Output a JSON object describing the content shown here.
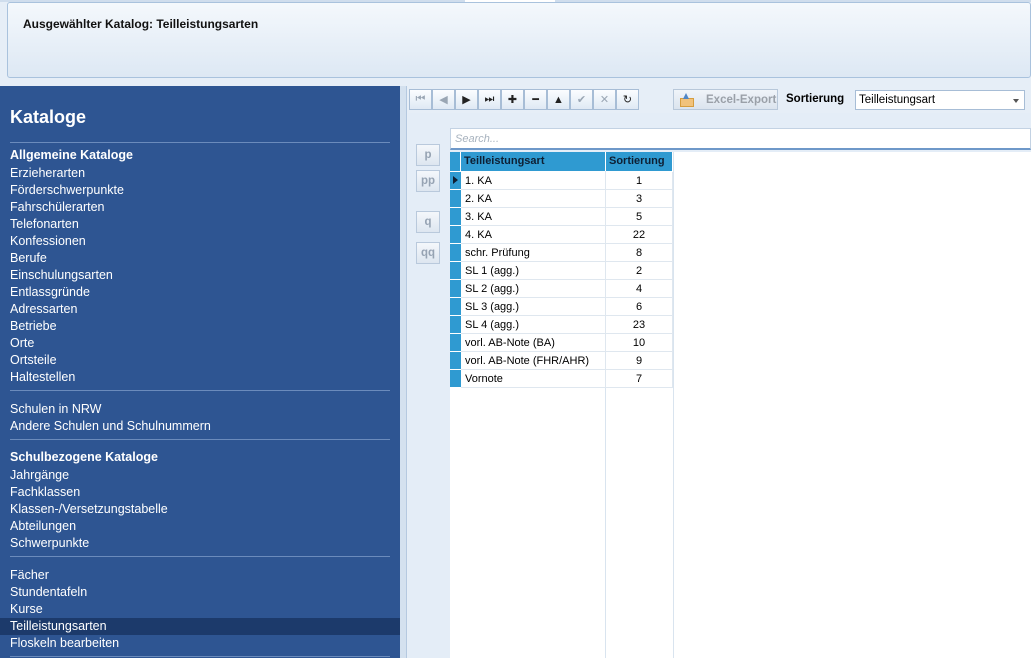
{
  "header": {
    "title": "Ausgewählter Katalog: Teilleistungsarten"
  },
  "sidebar": {
    "title": "Kataloge",
    "sections": [
      {
        "heading": "Allgemeine Kataloge",
        "items": [
          "Erzieherarten",
          "Förderschwerpunkte",
          "Fahrschülerarten",
          "Telefonarten",
          "Konfessionen",
          "Berufe",
          "Einschulungsarten",
          "Entlassgründe",
          "Adressarten",
          "Betriebe",
          "Orte",
          "Ortsteile",
          "Haltestellen"
        ]
      },
      {
        "heading": "",
        "items": [
          "Schulen in NRW",
          "Andere Schulen und Schulnummern"
        ]
      },
      {
        "heading": "Schulbezogene Kataloge",
        "items": [
          "Jahrgänge",
          "Fachklassen",
          "Klassen-/Versetzungstabelle",
          "Abteilungen",
          "Schwerpunkte"
        ]
      },
      {
        "heading": "",
        "items": [
          "Fächer",
          "Stundentafeln",
          "Kurse",
          "Teilleistungsarten",
          "Floskeln bearbeiten"
        ]
      }
    ],
    "active_item": "Teilleistungsarten"
  },
  "toolbar": {
    "buttons": [
      {
        "name": "first-record-icon",
        "glyph": "⏮",
        "enabled": false
      },
      {
        "name": "prev-record-icon",
        "glyph": "◀",
        "enabled": false
      },
      {
        "name": "next-record-icon",
        "glyph": "▶",
        "enabled": true
      },
      {
        "name": "last-record-icon",
        "glyph": "⏭",
        "enabled": true
      },
      {
        "name": "add-record-icon",
        "glyph": "✚",
        "enabled": true
      },
      {
        "name": "delete-record-icon",
        "glyph": "━",
        "enabled": true
      },
      {
        "name": "edit-record-icon",
        "glyph": "▲",
        "enabled": true
      },
      {
        "name": "post-edit-icon",
        "glyph": "✔",
        "enabled": false
      },
      {
        "name": "cancel-edit-icon",
        "glyph": "✕",
        "enabled": false
      },
      {
        "name": "refresh-icon",
        "glyph": "↻",
        "enabled": true
      }
    ],
    "excel_export_label": "Excel-Export",
    "sort_label": "Sortierung",
    "sort_value": "Teilleistungsart"
  },
  "side_buttons": [
    "p",
    "pp",
    "q",
    "qq"
  ],
  "search": {
    "placeholder": "Search..."
  },
  "grid": {
    "columns": [
      "Teilleistungsart",
      "Sortierung"
    ],
    "rows": [
      [
        "1. KA",
        "1"
      ],
      [
        "2. KA",
        "3"
      ],
      [
        "3. KA",
        "5"
      ],
      [
        "4. KA",
        "22"
      ],
      [
        "schr. Prüfung",
        "8"
      ],
      [
        "SL 1 (agg.)",
        "2"
      ],
      [
        "SL 2 (agg.)",
        "4"
      ],
      [
        "SL 3 (agg.)",
        "6"
      ],
      [
        "SL 4 (agg.)",
        "23"
      ],
      [
        "vorl. AB-Note (BA)",
        "10"
      ],
      [
        "vorl. AB-Note (FHR/AHR)",
        "9"
      ],
      [
        "Vornote",
        "7"
      ]
    ],
    "current_row": 0
  },
  "colors": {
    "sidebar_bg": "#2e5592",
    "sidebar_active": "#1c3a6b",
    "grid_header": "#2f9ad1"
  }
}
